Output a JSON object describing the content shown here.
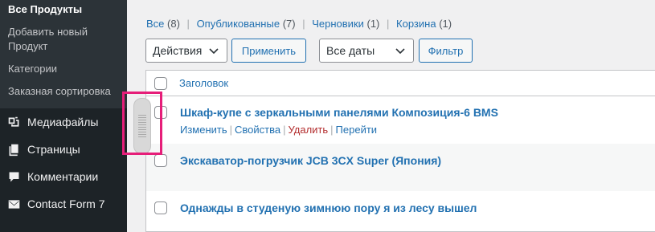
{
  "sidebar": {
    "submenu": [
      {
        "label": "Все Продукты",
        "current": true
      },
      {
        "label": "Добавить новый Продукт",
        "current": false
      },
      {
        "label": "Категории",
        "current": false
      },
      {
        "label": "Заказная сортировка",
        "current": false
      }
    ],
    "menu": [
      {
        "label": "Медиафайлы",
        "icon": "media-icon"
      },
      {
        "label": "Страницы",
        "icon": "pages-icon"
      },
      {
        "label": "Комментарии",
        "icon": "comments-icon"
      },
      {
        "label": "Contact Form 7",
        "icon": "envelope-icon"
      }
    ]
  },
  "filters": {
    "all": {
      "label": "Все",
      "count": "(8)"
    },
    "published": {
      "label": "Опубликованные",
      "count": "(7)"
    },
    "drafts": {
      "label": "Черновики",
      "count": "(1)"
    },
    "trash": {
      "label": "Корзина",
      "count": "(1)"
    }
  },
  "toolbar": {
    "bulk_actions": "Действия",
    "apply": "Применить",
    "dates": "Все даты",
    "filter": "Фильтр"
  },
  "table": {
    "header_title": "Заголовок",
    "rows": [
      {
        "title": "Шкаф-купе с зеркальными панелями Композиция-6 BMS"
      },
      {
        "title": "Экскаватор-погрузчик JCB 3CX Super (Япония)"
      },
      {
        "title": "Однажды в студеную зимнюю пору я из лесу вышел"
      }
    ],
    "row_actions": {
      "edit": "Изменить",
      "props": "Свойства",
      "delete": "Удалить",
      "view": "Перейти",
      "separator": "|"
    }
  },
  "colors": {
    "accent": "#2271b1",
    "sidebar_bg": "#1d2327",
    "delete": "#b32d2e",
    "highlight": "#e61e79"
  }
}
